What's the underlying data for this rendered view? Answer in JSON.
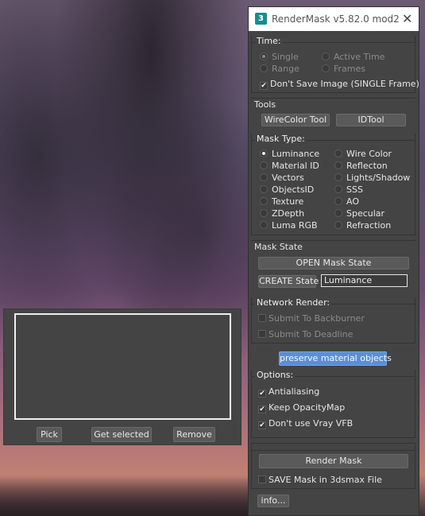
{
  "window": {
    "title": "RenderMask v5.82.0 mod2",
    "icon_label": "3"
  },
  "time": {
    "title": "Time:",
    "single": "Single",
    "active_time": "Active Time",
    "range": "Range",
    "frames": "Frames",
    "dont_save": "Don't Save Image (SINGLE Frame)"
  },
  "tools": {
    "title": "Tools",
    "wirecolor_tool": "WireColor Tool",
    "id_tool": "IDTool"
  },
  "mask_type": {
    "title": "Mask Type:",
    "left": [
      "Luminance",
      "Material ID",
      "Vectors",
      "ObjectsID",
      "Texture",
      "ZDepth",
      "Luma RGB"
    ],
    "right": [
      "Wire Color",
      "Reflecton",
      "Lights/Shadow",
      "SSS",
      "AO",
      "Specular",
      "Refraction"
    ],
    "selected": "Luminance"
  },
  "mask_state": {
    "title": "Mask State",
    "open_state": "OPEN Mask State",
    "create_state": "CREATE State",
    "state_name": "Luminance"
  },
  "network": {
    "title": "Network Render:",
    "backburner": "Submit To Backburner",
    "deadline": "Submit To Deadline",
    "preserve": "preserve material objects"
  },
  "options": {
    "title": "Options:",
    "antialiasing": "Antialiasing",
    "keep_opacity": "Keep OpacityMap",
    "no_vfb": "Don't use Vray VFB"
  },
  "render": {
    "render_mask": "Render Mask",
    "save_mask": "SAVE Mask in 3dsmax File",
    "info": "info..."
  },
  "pick_panel": {
    "pick": "Pick",
    "get_selected": "Get selected",
    "remove": "Remove"
  },
  "colors": {
    "panel_bg": "#444444",
    "button_bg": "#5a5a5a",
    "accent_blue": "#5b8ed6"
  }
}
